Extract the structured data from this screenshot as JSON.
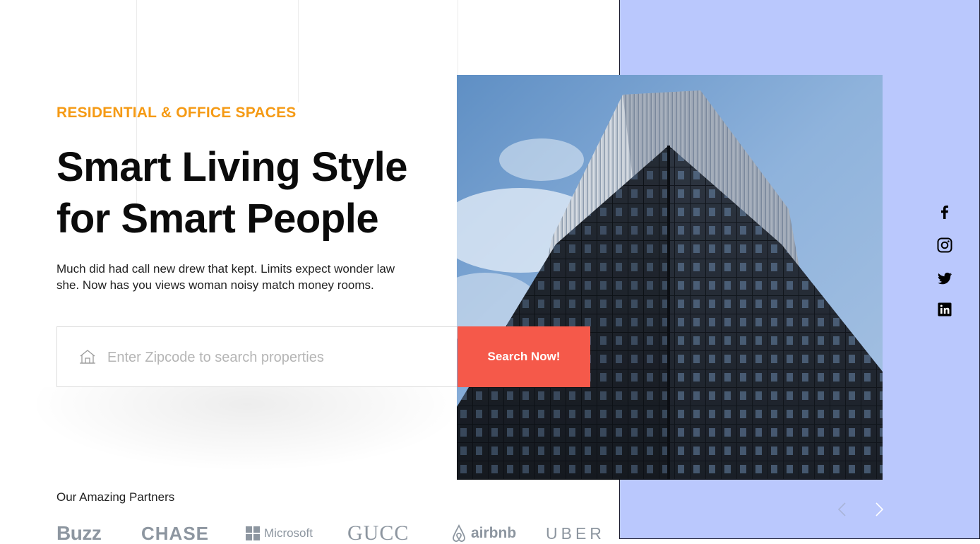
{
  "hero": {
    "eyebrow": "RESIDENTIAL & OFFICE SPACES",
    "headline_line1": "Smart Living Style",
    "headline_line2": "for Smart People",
    "intro": "Much did had call new drew that kept. Limits expect wonder law she. Now has you views woman noisy match money rooms."
  },
  "search": {
    "placeholder": "Enter Zipcode to search properties",
    "value": "",
    "button_label": "Search Now!",
    "icon": "home-icon"
  },
  "partners": {
    "label": "Our Amazing Partners",
    "logos": [
      "Buzz",
      "CHASE",
      "Microsoft",
      "GUCC",
      "airbnb",
      "UBER"
    ]
  },
  "social": [
    "facebook-icon",
    "instagram-icon",
    "twitter-icon",
    "linkedin-icon"
  ],
  "carousel": {
    "prev_icon": "chevron-left-icon",
    "next_icon": "chevron-right-icon"
  },
  "colors": {
    "accent_orange": "#f59a14",
    "button_red": "#f5594a",
    "panel_blue": "#bac8fd",
    "logo_gray": "#8d96a0"
  }
}
